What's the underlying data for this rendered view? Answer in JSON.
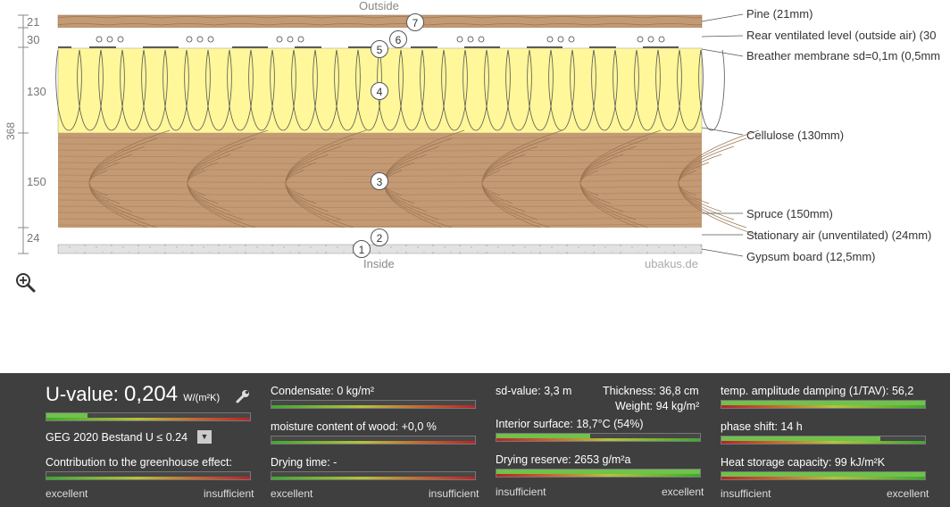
{
  "diagram": {
    "outside_label": "Outside",
    "inside_label": "Inside",
    "watermark": "ubakus.de",
    "total_thickness": "368",
    "dims": [
      "21",
      "30",
      "130",
      "150",
      "24"
    ],
    "layers": [
      {
        "num": "7",
        "label": "Pine (21mm)"
      },
      {
        "num": "6",
        "label": "Rear ventilated level (outside air) (30"
      },
      {
        "num": "5",
        "label": "Breather membrane sd=0,1m (0,5mm"
      },
      {
        "num": "4",
        "label": "Cellulose (130mm)"
      },
      {
        "num": "3",
        "label": "Spruce (150mm)"
      },
      {
        "num": "2",
        "label": "Stationary air (unventilated) (24mm)"
      },
      {
        "num": "1",
        "label": "Gypsum board (12,5mm)"
      }
    ],
    "colors": {
      "wood": "#c49a74",
      "insulation": "#fff799",
      "gypsum": "#e2e2e2"
    }
  },
  "panel": {
    "u_label": "U-value:",
    "u_value": "0,204",
    "u_unit": "W/(m²K)",
    "u_fraction": 0.2,
    "standard": "GEG 2020 Bestand U ≤ 0.24",
    "greenhouse": "Contribution to the greenhouse effect:",
    "scale_left": "excellent",
    "scale_right": "insufficient",
    "condensate": "Condensate: 0 kg/m²",
    "moisture": "moisture content of wood: +0,0 %",
    "drying_time": "Drying time: -",
    "sd": "sd-value: 3,3 m",
    "thickness": "Thickness: 36,8 cm",
    "weight": "Weight: 94 kg/m²",
    "interior": "Interior surface: 18,7°C (54%)",
    "interior_fraction": 0.46,
    "drying_reserve": "Drying reserve: 2653 g/m²a",
    "drying_reserve_fraction": 1.0,
    "scale2_left": "insufficient",
    "scale2_right": "excellent",
    "damping": "temp. amplitude damping (1/TAV): 56,2",
    "damping_fraction": 1.0,
    "phase": "phase shift: 14 h",
    "phase_fraction": 0.78,
    "heat": "Heat storage capacity: 99 kJ/m²K",
    "heat_fraction": 1.0
  }
}
